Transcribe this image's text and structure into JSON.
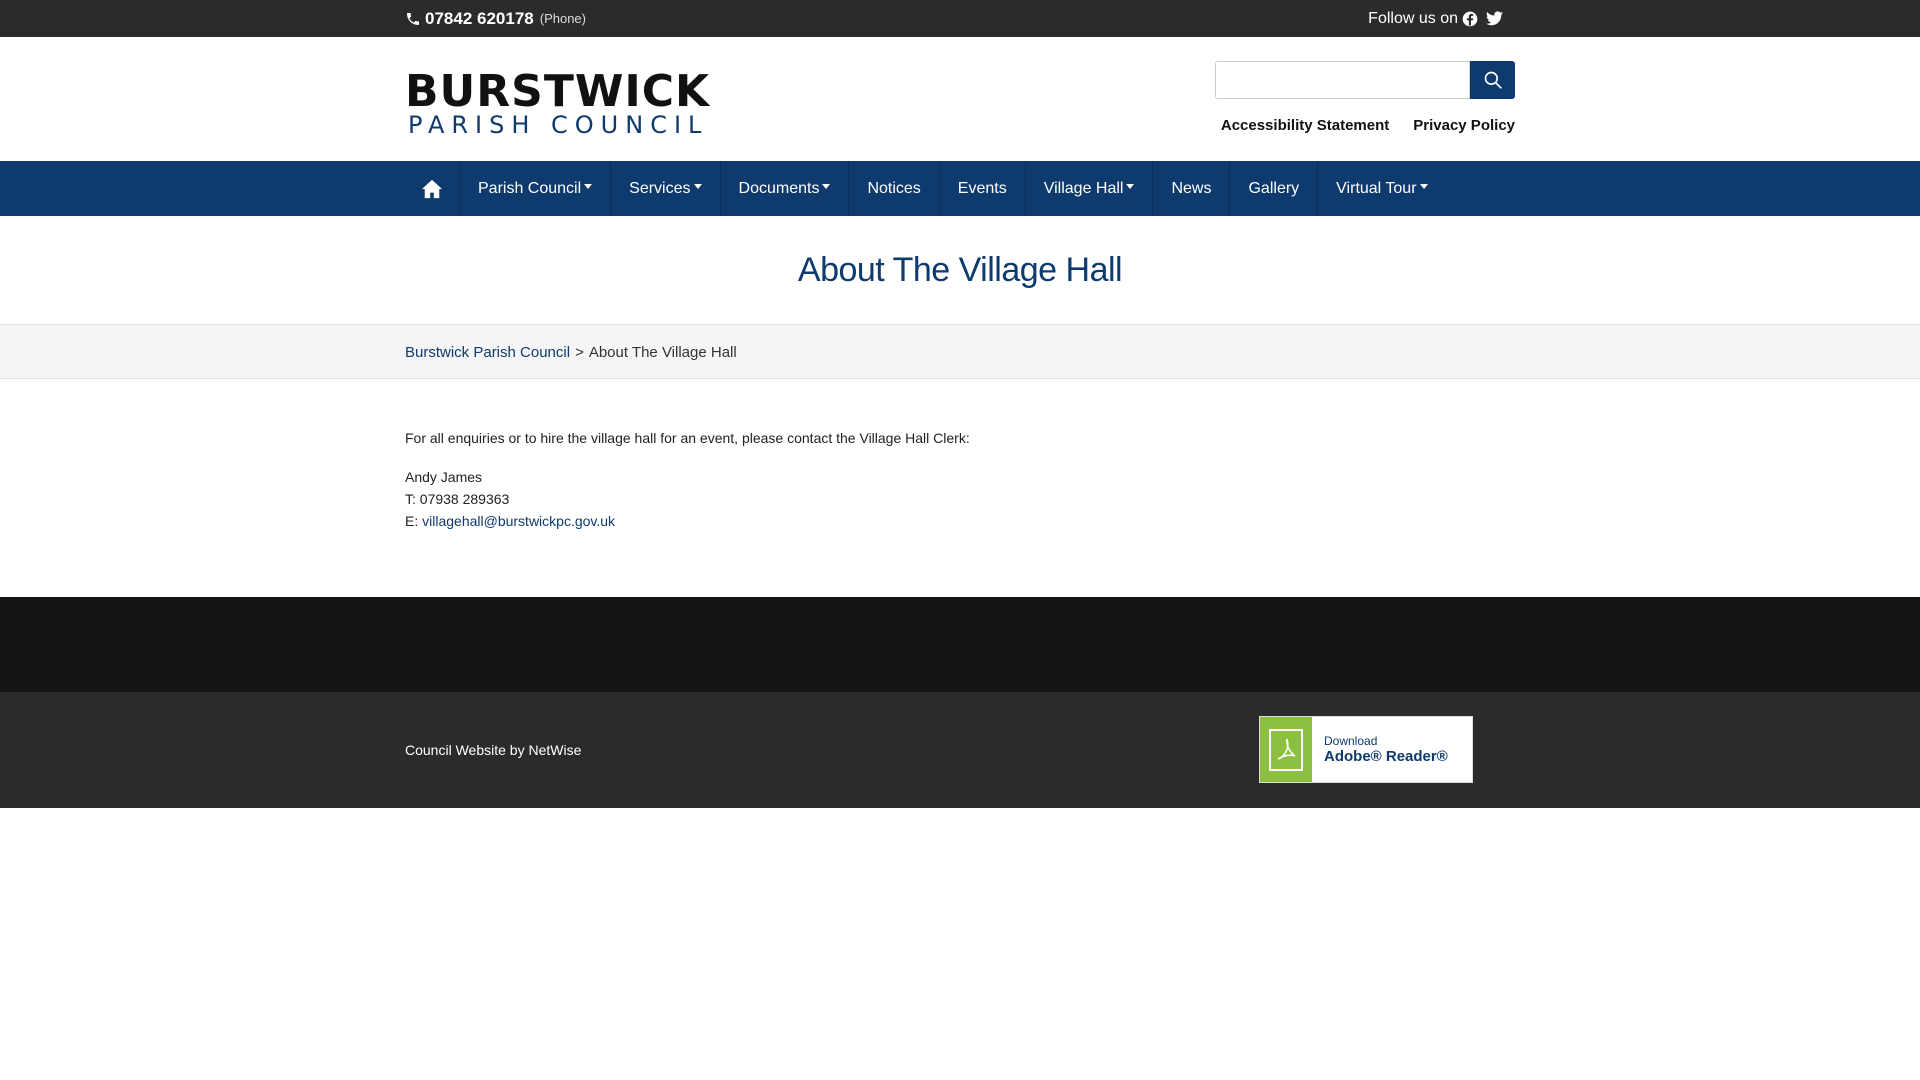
{
  "topbar": {
    "phone_number": "07842 620178",
    "phone_type": "(Phone)",
    "follow_label": "Follow us on"
  },
  "header": {
    "logo_line1": "BURSTWICK",
    "logo_line2": "PARISH COUNCIL",
    "search": {
      "placeholder": "",
      "value": ""
    },
    "links": [
      "Accessibility Statement",
      "Privacy Policy"
    ]
  },
  "nav": {
    "items": [
      {
        "label": "Parish Council",
        "dropdown": true
      },
      {
        "label": "Services",
        "dropdown": true
      },
      {
        "label": "Documents",
        "dropdown": true
      },
      {
        "label": "Notices",
        "dropdown": false
      },
      {
        "label": "Events",
        "dropdown": false
      },
      {
        "label": "Village Hall",
        "dropdown": true
      },
      {
        "label": "News",
        "dropdown": false
      },
      {
        "label": "Gallery",
        "dropdown": false
      },
      {
        "label": "Virtual Tour",
        "dropdown": true
      }
    ]
  },
  "page": {
    "title": "About The Village Hall",
    "breadcrumb": {
      "home": "Burstwick Parish Council",
      "separator": ">",
      "current": "About The Village Hall"
    }
  },
  "content": {
    "intro": "For all enquiries or to hire the village hall for an event, please contact the Village Hall Clerk:",
    "contact_name": "Andy James",
    "phone_line": "T: 07938 289363",
    "email_prefix": "E: ",
    "email": "villagehall@burstwickpc.gov.uk"
  },
  "footer": {
    "credit": "Council Website by NetWise",
    "adobe_line1": "Download",
    "adobe_line2": "Adobe® Reader®"
  },
  "colors": {
    "brand_navy": "#0e3a6e",
    "topbar": "#2b2b2b",
    "footer_dark": "#141414",
    "adobe_green": "#8cbf3f"
  },
  "icons": [
    "phone-icon",
    "facebook-icon",
    "twitter-icon",
    "search-icon",
    "home-icon",
    "pdf-icon"
  ]
}
